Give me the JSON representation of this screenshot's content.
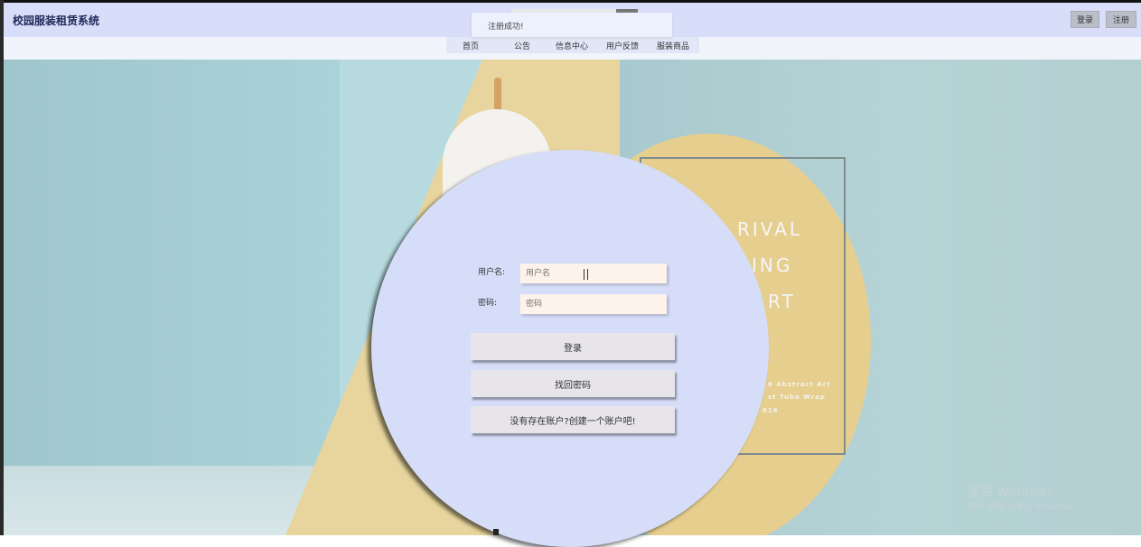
{
  "header": {
    "site_title": "校园服装租赁系统",
    "login_label": "登录",
    "register_label": "注册"
  },
  "toast": {
    "message": "注册成功!"
  },
  "nav": {
    "items": [
      "首页",
      "公告",
      "信息中心",
      "用户反馈",
      "服装商品"
    ]
  },
  "background": {
    "poster_lines": [
      "RIVAL",
      "ING",
      "RT"
    ],
    "poster_small": [
      "6 Abstract Art",
      "st Tube Wrap",
      "016"
    ]
  },
  "login_form": {
    "username_label": "用户名:",
    "username_placeholder": "用户名",
    "password_label": "密码:",
    "password_placeholder": "密码",
    "login_button": "登录",
    "forgot_button": "找回密码",
    "create_account_button": "没有存在账户?创建一个账户吧!"
  },
  "watermark": {
    "title": "激活 Windows",
    "subtitle": "转到\"设置\"以激活 Windows。"
  },
  "colors": {
    "header_bg": "#d8def9",
    "circle_bg": "#d6ddf8",
    "input_bg": "#fdf3ea"
  }
}
